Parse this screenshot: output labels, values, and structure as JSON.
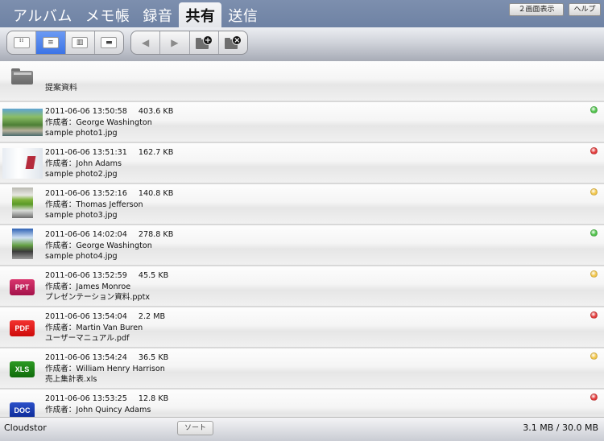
{
  "tabs": [
    {
      "label": "アルバム",
      "active": false
    },
    {
      "label": "メモ帳",
      "active": false
    },
    {
      "label": "録音",
      "active": false
    },
    {
      "label": "共有",
      "active": true
    },
    {
      "label": "送信",
      "active": false
    }
  ],
  "header_buttons": {
    "split_view": "２画面表示",
    "help": "ヘルプ"
  },
  "toolbar": {
    "view_modes": [
      {
        "name": "grid-view",
        "icon": "grid-icon",
        "glyph": "⠛",
        "active": false
      },
      {
        "name": "list-view",
        "icon": "list-icon",
        "glyph": "≡",
        "active": true
      },
      {
        "name": "column-view",
        "icon": "columns-icon",
        "glyph": "▥",
        "active": false
      },
      {
        "name": "filmstrip-view",
        "icon": "filmstrip-icon",
        "glyph": "▬",
        "active": false
      }
    ],
    "nav": {
      "back_glyph": "◀",
      "forward_glyph": "▶",
      "add_folder_badge": "+",
      "delete_folder_badge": "×"
    }
  },
  "folder": {
    "name": "提案資料",
    "icon": "folder-icon"
  },
  "files": [
    {
      "date": "2011-06-06 13:50:58",
      "size": "403.6 KB",
      "author": "作成者：George Washington",
      "filename": "sample photo1.jpg",
      "type": "photo",
      "status": "green"
    },
    {
      "date": "2011-06-06 13:51:31",
      "size": "162.7 KB",
      "author": "作成者：John Adams",
      "filename": "sample photo2.jpg",
      "type": "photo",
      "status": "red"
    },
    {
      "date": "2011-06-06 13:52:16",
      "size": "140.8 KB",
      "author": "作成者：Thomas Jefferson",
      "filename": "sample photo3.jpg",
      "type": "photo",
      "status": "yellow"
    },
    {
      "date": "2011-06-06 14:02:04",
      "size": "278.8 KB",
      "author": "作成者：George Washington",
      "filename": "sample photo4.jpg",
      "type": "photo",
      "status": "green"
    },
    {
      "date": "2011-06-06 13:52:59",
      "size": "45.5 KB",
      "author": "作成者：James Monroe",
      "filename": "プレゼンテーション資料.pptx",
      "type": "PPT",
      "status": "yellow"
    },
    {
      "date": "2011-06-06 13:54:04",
      "size": "2.2 MB",
      "author": "作成者：Martin Van Buren",
      "filename": "ユーザーマニュアル.pdf",
      "type": "PDF",
      "status": "red"
    },
    {
      "date": "2011-06-06 13:54:24",
      "size": "36.5 KB",
      "author": "作成者：William Henry Harrison",
      "filename": "売上集計表.xls",
      "type": "XLS",
      "status": "yellow"
    },
    {
      "date": "2011-06-06 13:53:25",
      "size": "12.8 KB",
      "author": "作成者：John Quincy Adams",
      "filename": "",
      "type": "DOC",
      "status": "red"
    }
  ],
  "status_colors": {
    "green": "#4fc24a",
    "red": "#e23a3a",
    "yellow": "#f2c64a"
  },
  "bottom": {
    "app_name": "Cloudstor",
    "sort_label": "ソート",
    "storage": "3.1 MB / 30.0 MB"
  }
}
